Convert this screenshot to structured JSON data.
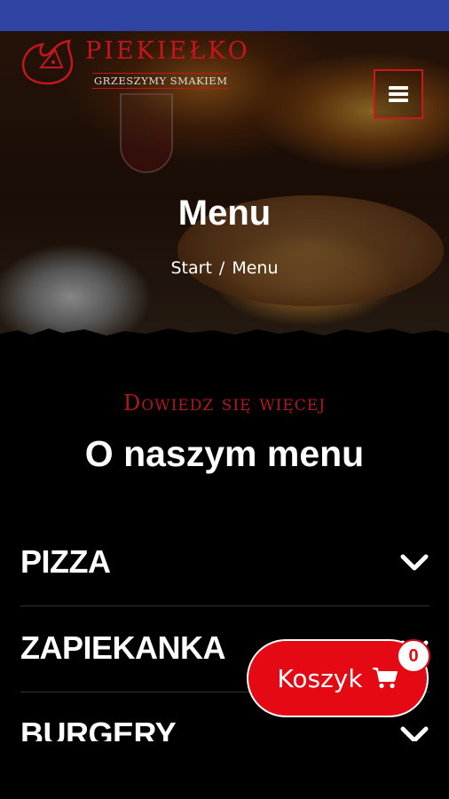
{
  "header": {
    "brand_name": "PIEKIEŁKO",
    "tagline": "GRZESZYMY SMAKIEM",
    "menu_icon": "hamburger-icon",
    "accent_color": "#c4161c"
  },
  "hero": {
    "title": "Menu",
    "breadcrumb": {
      "home": "Start",
      "separator": "/",
      "current": "Menu"
    }
  },
  "about": {
    "kicker": "Dowiedz się więcej",
    "title": "O naszym menu"
  },
  "menu_categories": [
    {
      "label": "PIZZA",
      "icon": "chevron-down-icon"
    },
    {
      "label": "ZAPIEKANKA",
      "icon": "chevron-down-icon"
    },
    {
      "label": "BURGERY",
      "icon": "chevron-down-icon"
    }
  ],
  "cart": {
    "label": "Koszyk",
    "icon": "shopping-cart-icon",
    "count": "0",
    "color": "#e50914"
  },
  "status_bar_color": "#2f44a3"
}
